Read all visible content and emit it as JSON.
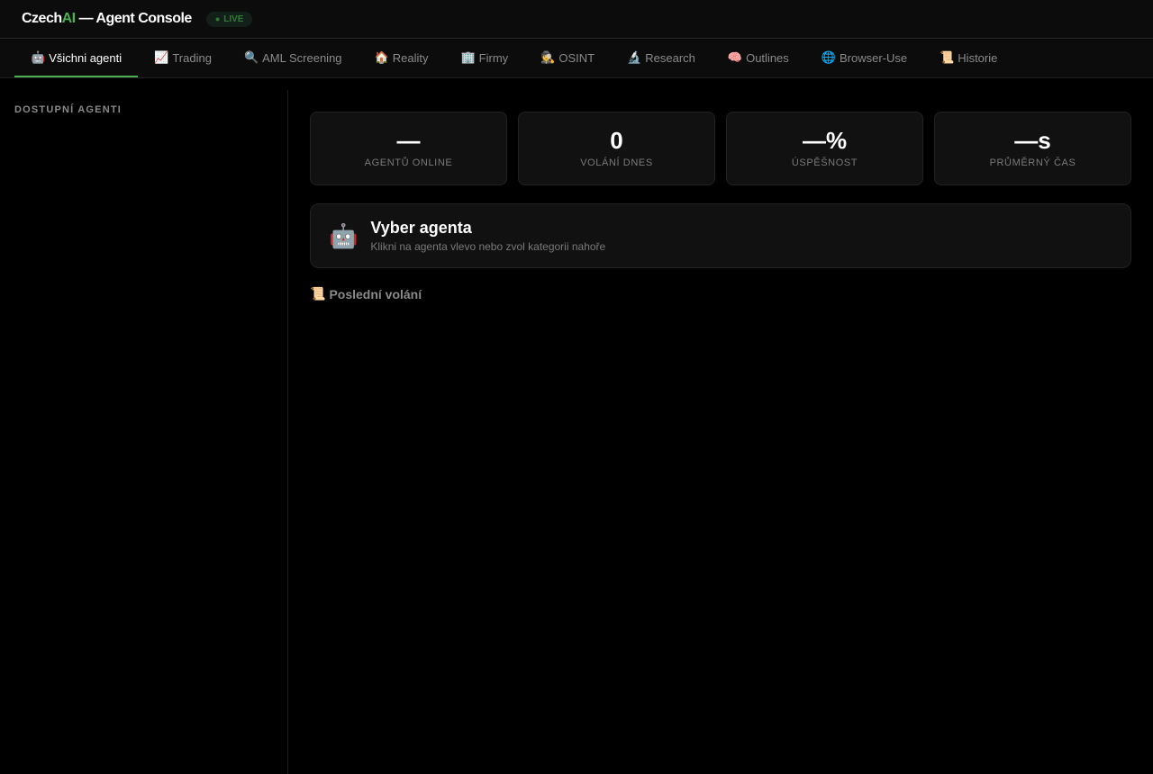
{
  "header": {
    "brand_prefix": "Czech",
    "brand_accent": "AI",
    "brand_suffix": " — Agent Console",
    "live_dot": "●",
    "live_label": "LIVE"
  },
  "tabs": [
    {
      "icon": "🤖",
      "icon_name": "robot-icon",
      "label": "Všichni agenti",
      "active": true
    },
    {
      "icon": "📈",
      "icon_name": "chart-up-icon",
      "label": "Trading"
    },
    {
      "icon": "🔍",
      "icon_name": "magnifier-icon",
      "label": "AML Screening"
    },
    {
      "icon": "🏠",
      "icon_name": "house-icon",
      "label": "Reality"
    },
    {
      "icon": "🏢",
      "icon_name": "office-building-icon",
      "label": "Firmy"
    },
    {
      "icon": "🕵",
      "icon_name": "detective-icon",
      "label": "OSINT"
    },
    {
      "icon": "🔬",
      "icon_name": "microscope-icon",
      "label": "Research"
    },
    {
      "icon": "🧠",
      "icon_name": "brain-icon",
      "label": "Outlines"
    },
    {
      "icon": "🌐",
      "icon_name": "globe-icon",
      "label": "Browser-Use"
    },
    {
      "icon": "📜",
      "icon_name": "scroll-icon",
      "label": "Historie"
    }
  ],
  "sidebar": {
    "title": "DOSTUPNÍ AGENTI"
  },
  "stats": [
    {
      "value": "—",
      "label": "AGENTŮ ONLINE"
    },
    {
      "value": "0",
      "label": "VOLÁNÍ DNES"
    },
    {
      "value": "—%",
      "label": "ÚSPĚŠNOST"
    },
    {
      "value": "—s",
      "label": "PRŮMĚRNÝ ČAS"
    }
  ],
  "select_card": {
    "icon": "🤖",
    "title": "Vyber agenta",
    "subtitle": "Klikni na agenta vlevo nebo zvol kategorii nahoře"
  },
  "recent": {
    "icon": "📜",
    "label": "Poslední volání"
  },
  "colors": {
    "accent": "#4caf50",
    "background": "#000000",
    "panel": "#111111"
  }
}
